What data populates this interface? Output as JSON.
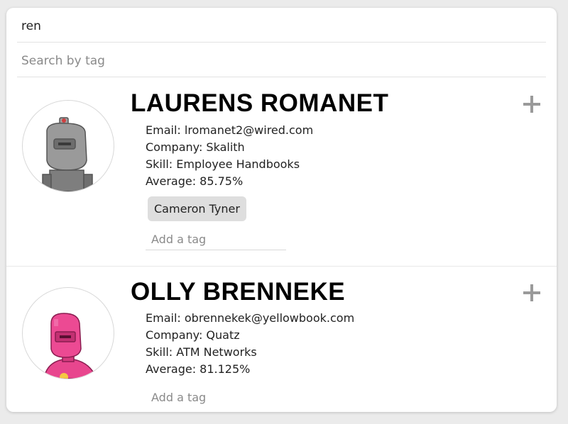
{
  "search": {
    "name_value": "ren",
    "tag_placeholder": "Search by tag"
  },
  "students": [
    {
      "name": "LAURENS ROMANET",
      "email": "Email: lromanet2@wired.com",
      "company": "Company: Skalith",
      "skill": "Skill: Employee Handbooks",
      "average": "Average: 85.75%",
      "tags": [
        "Cameron Tyner"
      ],
      "tag_placeholder": "Add a tag",
      "avatar_icon": "robot-avatar-gray",
      "expand_icon": "plus-icon"
    },
    {
      "name": "OLLY BRENNEKE",
      "email": "Email: obrennekek@yellowbook.com",
      "company": "Company: Quatz",
      "skill": "Skill: ATM Networks",
      "average": "Average: 81.125%",
      "tags": [],
      "tag_placeholder": "Add a tag",
      "avatar_icon": "robot-avatar-pink",
      "expand_icon": "plus-icon"
    }
  ],
  "colors": {
    "background": "#ebebeb",
    "card": "#ffffff",
    "tag_chip": "#dedede",
    "plus_icon": "#9a9a9a",
    "robot_gray": "#8c8c8c",
    "robot_pink": "#e8468e"
  }
}
